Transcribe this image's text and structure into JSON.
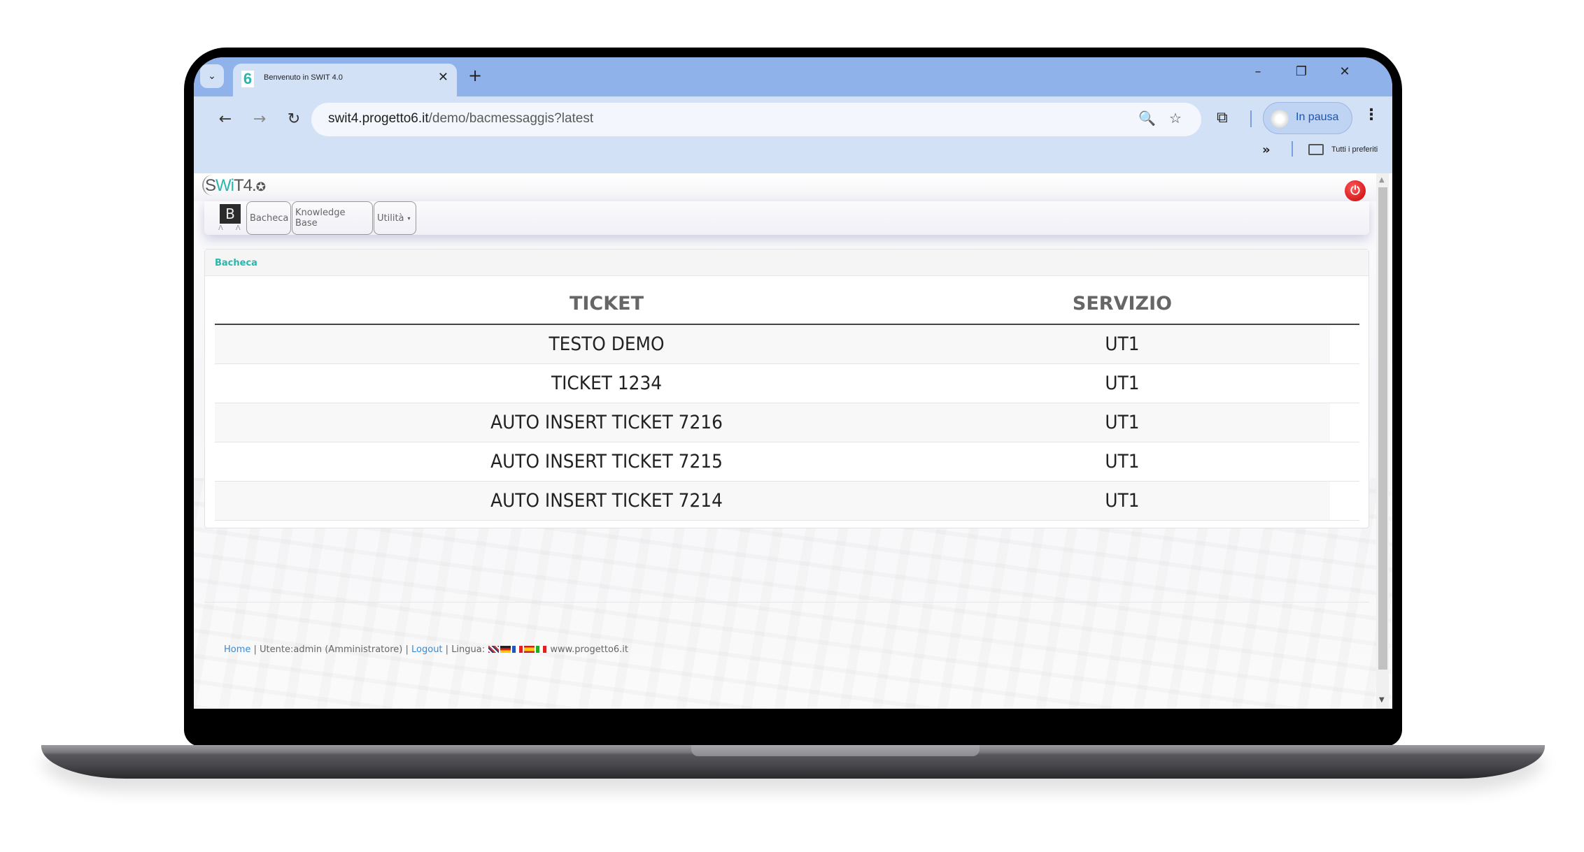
{
  "browser": {
    "tab": {
      "title": "Benvenuto in SWIT 4.0",
      "favicon": "6"
    },
    "new_tab_label": "+",
    "window_controls": {
      "minimize": "–",
      "restore": "❐",
      "close": "✕"
    },
    "url": {
      "host": "swit4.progetto6.it",
      "path": "/demo/bacmessaggis?latest"
    },
    "profile_label": "In pausa",
    "bookmarks": {
      "overflow": "»",
      "all_bookmarks_label": "Tutti i preferiti"
    },
    "icons": {
      "tab_search": "⌄",
      "back": "←",
      "forward": "→",
      "reload": "↻",
      "zoom": "🔍",
      "star": "☆",
      "extensions": "⧉",
      "menu": "⋮",
      "close_tab": "✕"
    }
  },
  "app": {
    "logo": {
      "prefix": "S",
      "teal": "Wi",
      "suffix": "T4.",
      "gear": "✪"
    },
    "power_icon": "⏻",
    "navbar": {
      "brand": "B",
      "items": [
        {
          "label": "Bacheca"
        },
        {
          "label": "Knowledge Base"
        },
        {
          "label": "Utilità",
          "has_dropdown": true
        }
      ],
      "caret": "▾"
    },
    "panel": {
      "title": "Bacheca",
      "table": {
        "headers": [
          "TICKET",
          "SERVIZIO"
        ],
        "rows": [
          [
            "TESTO DEMO",
            "UT1"
          ],
          [
            "TICKET 1234",
            "UT1"
          ],
          [
            "AUTO INSERT TICKET 7216",
            "UT1"
          ],
          [
            "AUTO INSERT TICKET 7215",
            "UT1"
          ],
          [
            "AUTO INSERT TICKET 7214",
            "UT1"
          ]
        ]
      }
    },
    "footer": {
      "home": "Home",
      "sep": " | ",
      "user": "Utente:admin (Amministratore)",
      "logout": "Logout",
      "language_label": "Lingua:",
      "languages": [
        "en",
        "de",
        "fr",
        "es",
        "it"
      ],
      "site": "www.progetto6.it"
    },
    "colors": {
      "accent": "#2bb5ad",
      "link": "#3a8ad6",
      "power": "#d01010"
    }
  }
}
